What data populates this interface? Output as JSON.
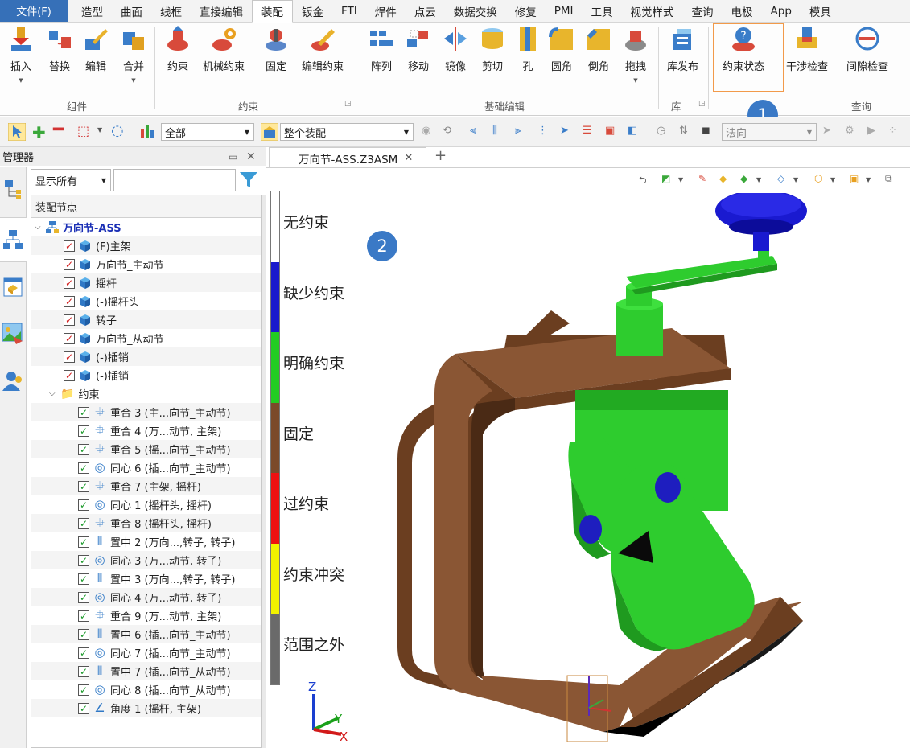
{
  "menu_tabs": [
    "文件(F)",
    "造型",
    "曲面",
    "线框",
    "直接编辑",
    "装配",
    "钣金",
    "FTI",
    "焊件",
    "点云",
    "数据交换",
    "修复",
    "PMI",
    "工具",
    "视觉样式",
    "查询",
    "电极",
    "App",
    "模具"
  ],
  "ribbon": {
    "buttons": [
      {
        "label": "插入"
      },
      {
        "label": "替换"
      },
      {
        "label": "编辑"
      },
      {
        "label": "合并"
      },
      {
        "label": "约束"
      },
      {
        "label": "机械约束"
      },
      {
        "label": "固定"
      },
      {
        "label": "编辑约束"
      },
      {
        "label": "阵列"
      },
      {
        "label": "移动"
      },
      {
        "label": "镜像"
      },
      {
        "label": "剪切"
      },
      {
        "label": "孔"
      },
      {
        "label": "圆角"
      },
      {
        "label": "倒角"
      },
      {
        "label": "拖拽"
      },
      {
        "label": "库发布"
      },
      {
        "label": "约束状态"
      },
      {
        "label": "干涉检查"
      },
      {
        "label": "间隙检查"
      }
    ],
    "groups": [
      "组件",
      "约束",
      "基础编辑",
      "库",
      "查询"
    ]
  },
  "callouts": [
    "1",
    "2"
  ],
  "toolbar": {
    "filter_value": "全部",
    "assembly_value": "整个装配",
    "normal_value": "法向"
  },
  "manager": {
    "title": "管理器",
    "filter_value": "显示所有",
    "header": "装配节点",
    "root": "万向节-ASS",
    "components": [
      "(F)主架",
      "万向节_主动节",
      "摇杆",
      "(-)摇杆头",
      "转子",
      "万向节_从动节",
      "(-)插销",
      "(-)插销"
    ],
    "constraints_folder": "约束",
    "constraints": [
      {
        "type": "coincident",
        "label": "重合 3 (主...向节_主动节)"
      },
      {
        "type": "coincident",
        "label": "重合 4 (万...动节, 主架)"
      },
      {
        "type": "coincident",
        "label": "重合 5 (摇...向节_主动节)"
      },
      {
        "type": "concentric",
        "label": "同心 6 (插...向节_主动节)"
      },
      {
        "type": "coincident",
        "label": "重合 7 (主架, 摇杆)"
      },
      {
        "type": "concentric",
        "label": "同心 1 (摇杆头, 摇杆)"
      },
      {
        "type": "coincident",
        "label": "重合 8 (摇杆头, 摇杆)"
      },
      {
        "type": "center",
        "label": "置中 2 (万向...,转子, 转子)"
      },
      {
        "type": "concentric",
        "label": "同心 3 (万...动节, 转子)"
      },
      {
        "type": "center",
        "label": "置中 3 (万向...,转子, 转子)"
      },
      {
        "type": "concentric",
        "label": "同心 4 (万...动节, 转子)"
      },
      {
        "type": "coincident",
        "label": "重合 9 (万...动节, 主架)"
      },
      {
        "type": "center",
        "label": "置中 6 (插...向节_主动节)"
      },
      {
        "type": "concentric",
        "label": "同心 7 (插...向节_主动节)"
      },
      {
        "type": "center",
        "label": "置中 7 (插...向节_从动节)"
      },
      {
        "type": "concentric",
        "label": "同心 8 (插...向节_从动节)"
      },
      {
        "type": "angle",
        "label": "角度 1 (摇杆, 主架)"
      }
    ]
  },
  "document_tab": "万向节-ASS.Z3ASM",
  "legend": [
    {
      "label": "无约束",
      "color": "#ffffff"
    },
    {
      "label": "缺少约束",
      "color": "#1a1acc"
    },
    {
      "label": "明确约束",
      "color": "#22cc22"
    },
    {
      "label": "固定",
      "color": "#7b4a2a"
    },
    {
      "label": "过约束",
      "color": "#ee1111"
    },
    {
      "label": "约束冲突",
      "color": "#f2f200"
    },
    {
      "label": "范围之外",
      "color": "#6a6a6a"
    }
  ],
  "axes": {
    "z": "Z",
    "y": "Y",
    "x": "X"
  }
}
